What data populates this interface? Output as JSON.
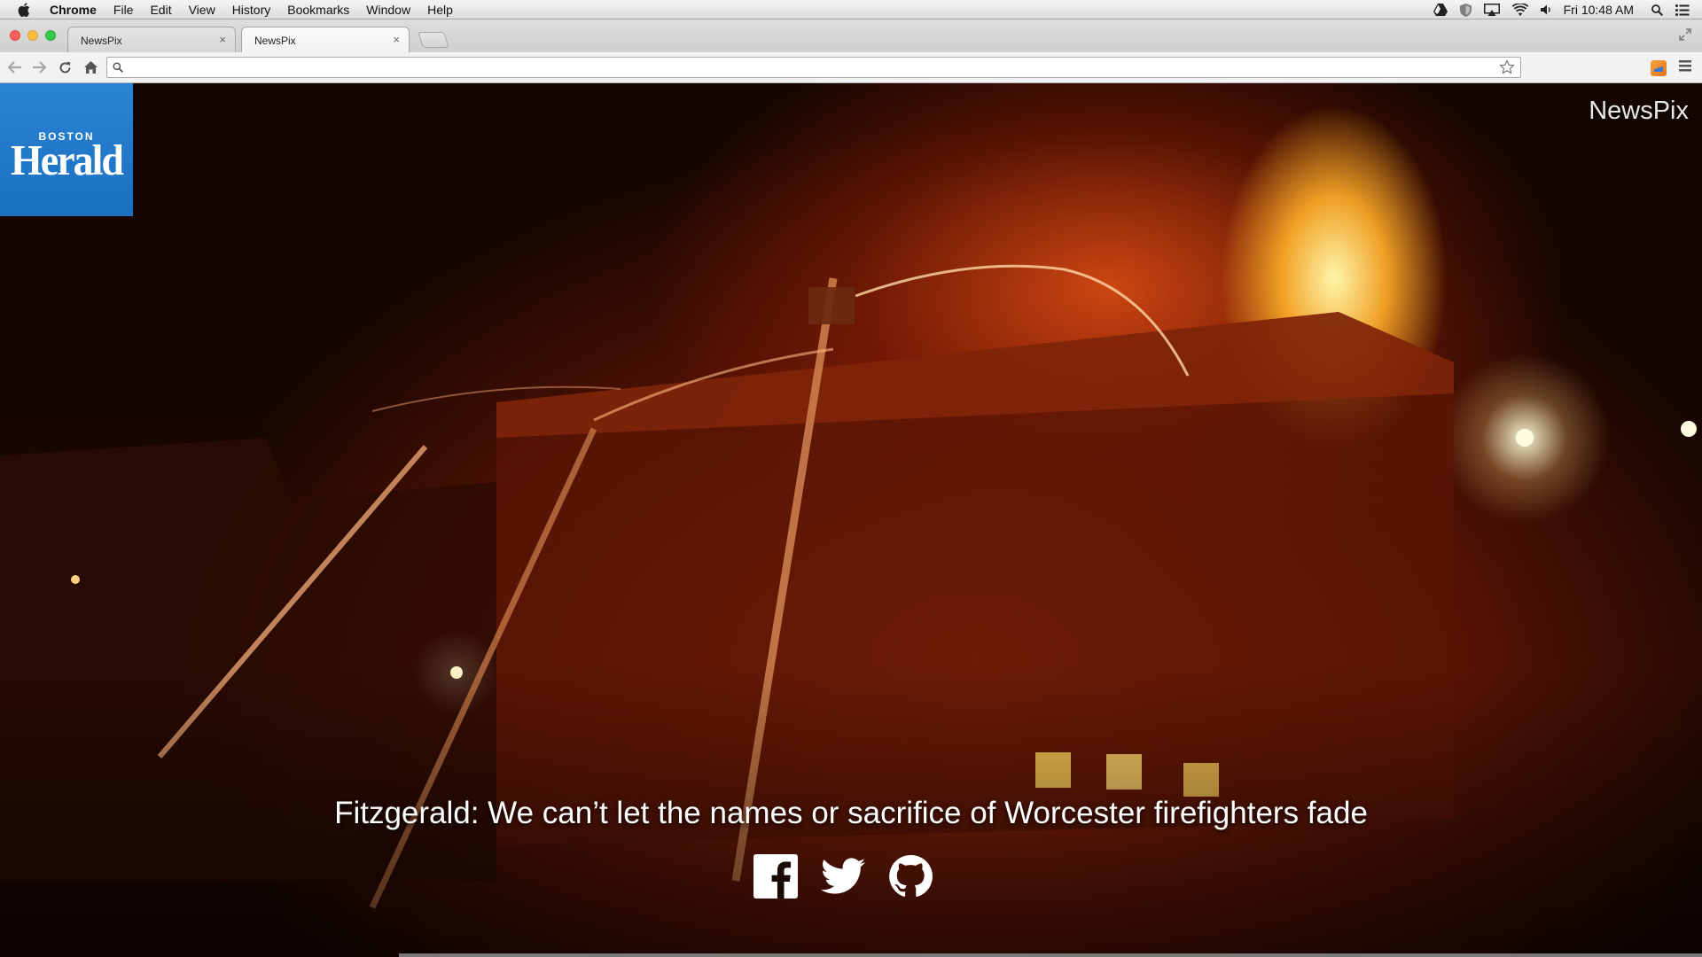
{
  "menubar": {
    "app_name": "Chrome",
    "items": [
      "File",
      "Edit",
      "View",
      "History",
      "Bookmarks",
      "Window",
      "Help"
    ],
    "clock": "Fri 10:48 AM"
  },
  "tabs": [
    {
      "title": "NewsPix",
      "close": "×"
    },
    {
      "title": "NewsPix",
      "close": "×"
    }
  ],
  "omnibox": {
    "value": "",
    "placeholder": ""
  },
  "page": {
    "logo_small": "BOSTON",
    "logo_big": "Herald",
    "site_title": "NewsPix",
    "headline": "Fitzgerald: We can’t let the names or sacrifice of Worcester firefighters fade"
  },
  "icons": {
    "social": [
      "facebook-icon",
      "twitter-icon",
      "github-icon"
    ],
    "browser": [
      "back-icon",
      "forward-icon",
      "reload-icon",
      "home-icon",
      "search-icon",
      "star-icon",
      "menu-icon"
    ]
  },
  "colors": {
    "logo_blue": "#1f78c8",
    "fire_orange": "#e05a12",
    "headline_text": "#ffffff"
  }
}
